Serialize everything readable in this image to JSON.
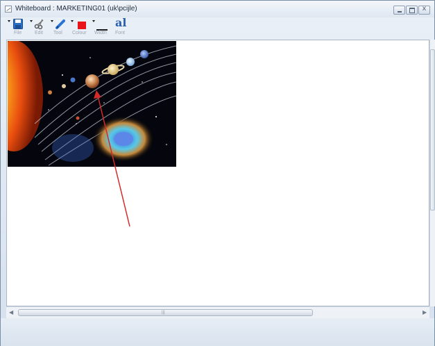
{
  "window": {
    "title": "Whiteboard : MARKETING01 (uk\\pcijle)"
  },
  "toolbar": {
    "items": [
      {
        "label": "File",
        "icon": "save-icon"
      },
      {
        "label": "Edit",
        "icon": "scissors-icon"
      },
      {
        "label": "Tool",
        "icon": "pen-icon"
      },
      {
        "label": "Colour",
        "icon": "color-swatch-icon"
      },
      {
        "label": "Width",
        "icon": "line-width-icon"
      },
      {
        "label": "Font",
        "icon": "font-icon",
        "glyph": "al"
      }
    ]
  },
  "colors": {
    "swatch": "#e8141a",
    "arrow": "#d42a2a",
    "save_blue": "#2b6fc4"
  },
  "canvas": {
    "image": "solar-system-image",
    "annotation": "red-arrow"
  }
}
